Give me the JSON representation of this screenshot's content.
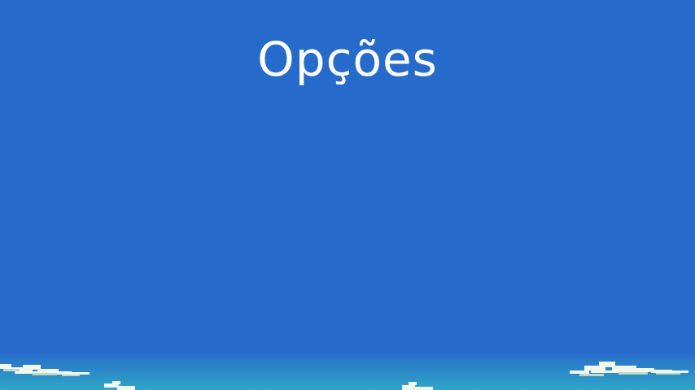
{
  "screen": {
    "title": "Opções"
  },
  "colors": {
    "sky": "#266bcb",
    "horizon_top": "#2a78c8",
    "horizon_bottom": "#2fa3c9",
    "cloud": "#f2f7ee",
    "cloud_shade": "#bfd9c8",
    "title_text": "#ffffff"
  }
}
